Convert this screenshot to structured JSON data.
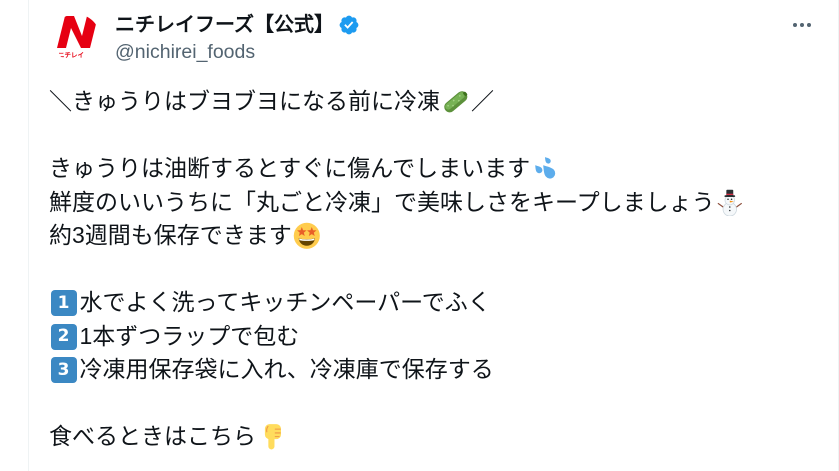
{
  "colors": {
    "text": "#0f1419",
    "secondary": "#536471",
    "verified": "#1d9bf0",
    "keycap": "#3b88c3",
    "brand_red": "#e60012",
    "border": "#eff3f4"
  },
  "author": {
    "name": "ニチレイフーズ【公式】",
    "handle": "@nichirei_foods",
    "verified": true,
    "avatar_logo_text": "ニチレイ",
    "verified_icon": "verified-badge",
    "more_icon": "more-horizontal"
  },
  "tweet": {
    "headline": {
      "text": "＼きゅうりはブヨブヨになる前に冷凍",
      "emoji": "cucumber",
      "tail": "／"
    },
    "intro": [
      {
        "text": "きゅうりは油断するとすぐに傷んでしまいます",
        "emoji": "sweat-droplets"
      },
      {
        "text": "鮮度のいいうちに「丸ごと冷凍」で美味しさをキープしましょう",
        "emoji": "snowman"
      },
      {
        "text": "約3週間も保存できます",
        "emoji": "star-struck"
      }
    ],
    "steps": [
      {
        "number": "1",
        "text": "水でよく洗ってキッチンペーパーでふく"
      },
      {
        "number": "2",
        "text": "1本ずつラップで包む"
      },
      {
        "number": "3",
        "text": "冷凍用保存袋に入れ、冷凍庫で保存する"
      }
    ],
    "closing": {
      "text": "食べるときはこちら",
      "emoji": "backhand-index-pointing-down"
    }
  }
}
